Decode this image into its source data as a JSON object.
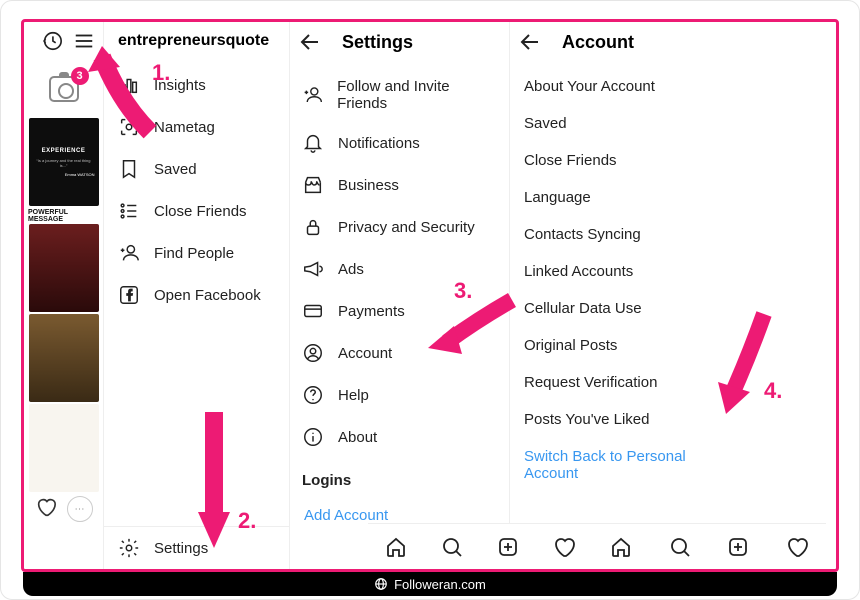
{
  "badge": "3",
  "drawer": {
    "title": "entrepreneursquote",
    "items": [
      "Insights",
      "Nametag",
      "Saved",
      "Close Friends",
      "Find People",
      "Open Facebook"
    ],
    "settings": "Settings"
  },
  "settings": {
    "title": "Settings",
    "items": [
      "Follow and Invite Friends",
      "Notifications",
      "Business",
      "Privacy and Security",
      "Ads",
      "Payments",
      "Account",
      "Help",
      "About"
    ],
    "section": "Logins",
    "add": "Add Account"
  },
  "account": {
    "title": "Account",
    "items": [
      "About Your Account",
      "Saved",
      "Close Friends",
      "Language",
      "Contacts Syncing",
      "Linked Accounts",
      "Cellular Data Use",
      "Original Posts",
      "Request Verification",
      "Posts You've Liked"
    ],
    "switch": "Switch Back to Personal Account"
  },
  "steps": {
    "s1": "1.",
    "s2": "2.",
    "s3": "3.",
    "s4": "4."
  },
  "posts": {
    "exp": "EXPERIENCE",
    "pm": "POWERFUL MESSAGE"
  },
  "credit": "Followeran.com"
}
